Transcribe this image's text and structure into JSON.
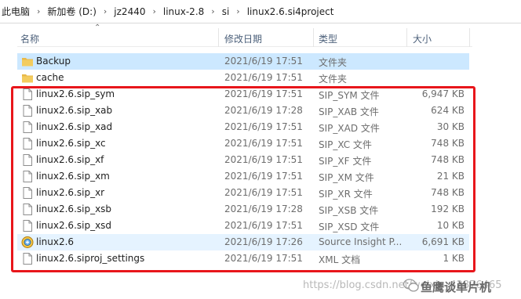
{
  "breadcrumb": {
    "items": [
      "此电脑",
      "新加卷 (D:)",
      "jz2440",
      "linux-2.8",
      "si",
      "linux2.6.si4project"
    ],
    "separator": "›"
  },
  "columns": {
    "name": "名称",
    "date": "修改日期",
    "type": "类型",
    "size": "大小"
  },
  "files": [
    {
      "name": "Backup",
      "date": "2021/6/19 17:51",
      "type": "文件夹",
      "size": "",
      "icon": "folder-icon",
      "state": "selected"
    },
    {
      "name": "cache",
      "date": "2021/6/19 17:51",
      "type": "文件夹",
      "size": "",
      "icon": "folder-icon",
      "state": ""
    },
    {
      "name": "linux2.6.sip_sym",
      "date": "2021/6/19 17:51",
      "type": "SIP_SYM 文件",
      "size": "6,947 KB",
      "icon": "file-icon",
      "state": ""
    },
    {
      "name": "linux2.6.sip_xab",
      "date": "2021/6/19 17:28",
      "type": "SIP_XAB 文件",
      "size": "624 KB",
      "icon": "file-icon",
      "state": ""
    },
    {
      "name": "linux2.6.sip_xad",
      "date": "2021/6/19 17:51",
      "type": "SIP_XAD 文件",
      "size": "30 KB",
      "icon": "file-icon",
      "state": ""
    },
    {
      "name": "linux2.6.sip_xc",
      "date": "2021/6/19 17:51",
      "type": "SIP_XC 文件",
      "size": "748 KB",
      "icon": "file-icon",
      "state": ""
    },
    {
      "name": "linux2.6.sip_xf",
      "date": "2021/6/19 17:51",
      "type": "SIP_XF 文件",
      "size": "748 KB",
      "icon": "file-icon",
      "state": ""
    },
    {
      "name": "linux2.6.sip_xm",
      "date": "2021/6/19 17:51",
      "type": "SIP_XM 文件",
      "size": "21 KB",
      "icon": "file-icon",
      "state": ""
    },
    {
      "name": "linux2.6.sip_xr",
      "date": "2021/6/19 17:51",
      "type": "SIP_XR 文件",
      "size": "748 KB",
      "icon": "file-icon",
      "state": ""
    },
    {
      "name": "linux2.6.sip_xsb",
      "date": "2021/6/19 17:28",
      "type": "SIP_XSB 文件",
      "size": "192 KB",
      "icon": "file-icon",
      "state": ""
    },
    {
      "name": "linux2.6.sip_xsd",
      "date": "2021/6/19 17:51",
      "type": "SIP_XSD 文件",
      "size": "10 KB",
      "icon": "file-icon",
      "state": ""
    },
    {
      "name": "linux2.6",
      "date": "2021/6/19 17:26",
      "type": "Source Insight P...",
      "size": "6,691 KB",
      "icon": "source-insight-icon",
      "state": "hover"
    },
    {
      "name": "linux2.6.siproj_settings",
      "date": "2021/6/19 17:51",
      "type": "XML 文档",
      "size": "1 KB",
      "icon": "file-icon",
      "state": ""
    }
  ],
  "watermark": {
    "url": "https://blog.csdn.net/weixin_42876465",
    "brand": "鱼鹰谈单片机"
  },
  "colors": {
    "selected_row": "#cce8ff",
    "hover_row": "#e5f3ff",
    "annotation_box": "#e8161b",
    "folder": "#e8b94a",
    "header_text": "#4c607a"
  }
}
